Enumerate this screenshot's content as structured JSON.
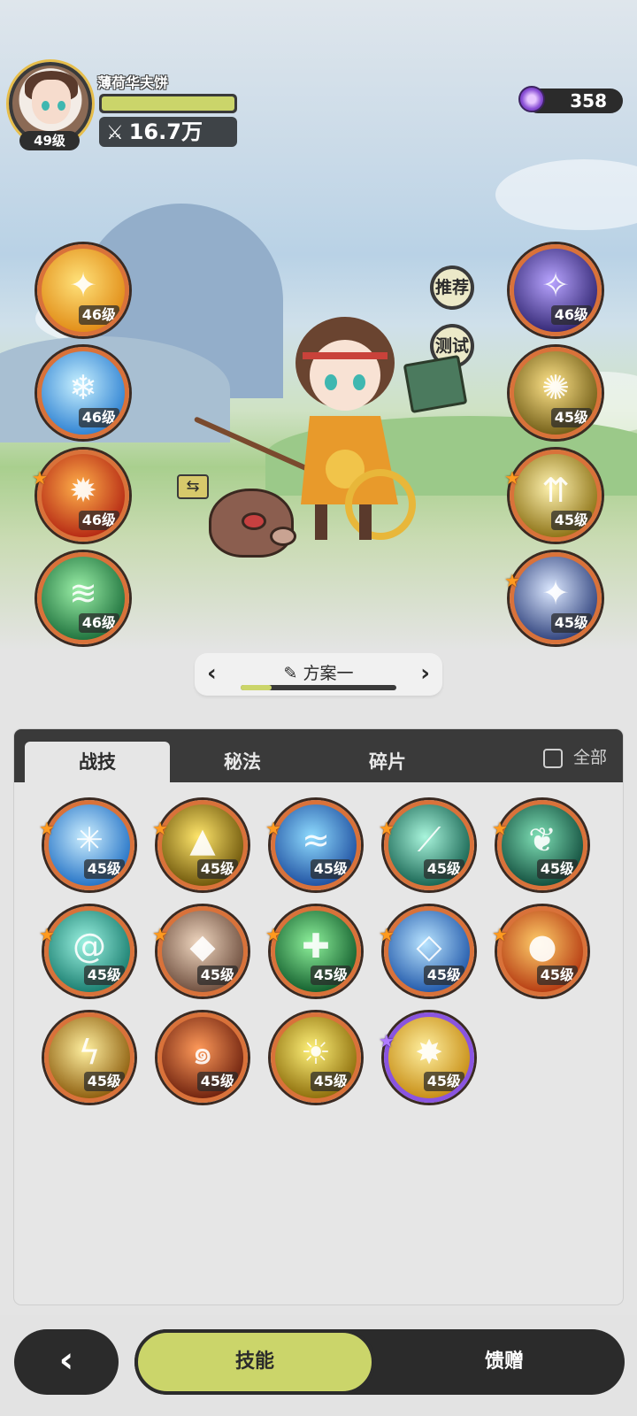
{
  "player": {
    "name": "薄荷华夫饼",
    "level": "49级",
    "hp_fill_percent": 100,
    "power": "16.7万"
  },
  "currency": {
    "icon": "purple-gem-icon",
    "amount": "358"
  },
  "side_buttons": {
    "recommend": "推荐",
    "test": "测试"
  },
  "equipped_left": [
    {
      "level": "46级",
      "icon": "golden-slash-icon",
      "starred": false
    },
    {
      "level": "46级",
      "icon": "ice-crystal-icon",
      "starred": false
    },
    {
      "level": "46级",
      "icon": "fire-burst-icon",
      "starred": true
    },
    {
      "level": "46级",
      "icon": "green-wind-icon",
      "starred": false
    }
  ],
  "equipped_right": [
    {
      "level": "46级",
      "icon": "purple-vortex-icon",
      "starred": false
    },
    {
      "level": "45级",
      "icon": "golden-burst-icon",
      "starred": false
    },
    {
      "level": "45级",
      "icon": "light-pillar-icon",
      "starred": true
    },
    {
      "level": "45级",
      "icon": "blue-star-icon",
      "starred": true
    }
  ],
  "plan": {
    "label": "方案一",
    "progress_percent": 20
  },
  "tabs": [
    {
      "label": "战技",
      "active": true
    },
    {
      "label": "秘法",
      "active": false
    },
    {
      "label": "碎片",
      "active": false
    }
  ],
  "filter": {
    "label": "全部",
    "checked": false
  },
  "skills": [
    {
      "level": "45级",
      "icon": "ice-splash-icon",
      "star": "orange"
    },
    {
      "level": "45级",
      "icon": "golden-triangle-icon",
      "star": "orange"
    },
    {
      "level": "45级",
      "icon": "water-wave-icon",
      "star": "orange"
    },
    {
      "level": "45级",
      "icon": "teal-slash-icon",
      "star": "orange"
    },
    {
      "level": "45级",
      "icon": "thorn-vine-icon",
      "star": "orange"
    },
    {
      "level": "45级",
      "icon": "teal-swirl-icon",
      "star": "orange"
    },
    {
      "level": "45级",
      "icon": "rock-card-icon",
      "star": "orange"
    },
    {
      "level": "45级",
      "icon": "green-heal-cross-icon",
      "star": "orange"
    },
    {
      "level": "45级",
      "icon": "ice-shard-icon",
      "star": "orange"
    },
    {
      "level": "45级",
      "icon": "fire-orb-icon",
      "star": "orange"
    },
    {
      "level": "45级",
      "icon": "lightning-strike-icon",
      "star": "none"
    },
    {
      "level": "45级",
      "icon": "flame-swirl-icon",
      "star": "none"
    },
    {
      "level": "45级",
      "icon": "sun-rise-icon",
      "star": "none"
    },
    {
      "level": "45级",
      "icon": "golden-explosion-icon",
      "star": "purple"
    }
  ],
  "nav": {
    "back_icon": "chevron-left-icon",
    "skills_label": "技能",
    "gift_label": "馈赠"
  }
}
